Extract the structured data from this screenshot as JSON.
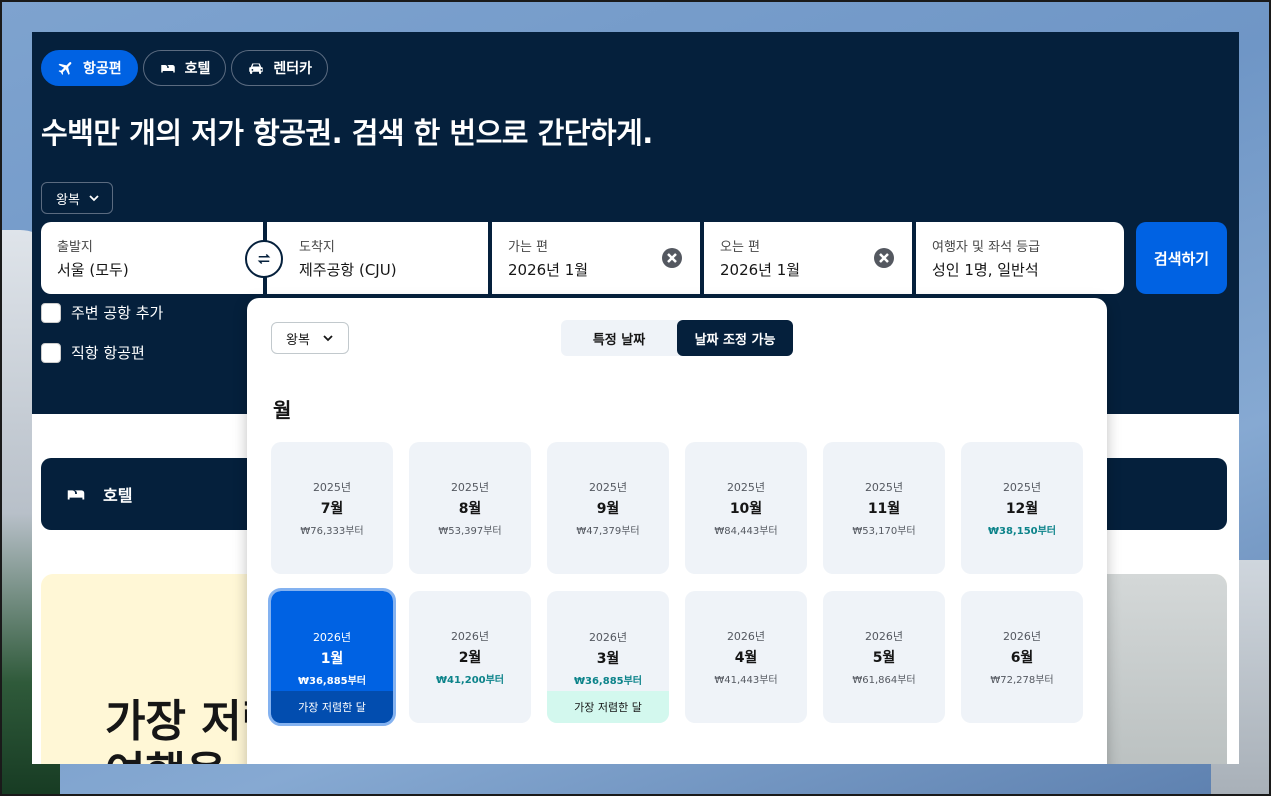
{
  "tabs": [
    {
      "label": "항공편",
      "icon": "airplane-icon",
      "active": true
    },
    {
      "label": "호텔",
      "icon": "bed-icon",
      "active": false
    },
    {
      "label": "렌터카",
      "icon": "car-icon",
      "active": false
    }
  ],
  "hero_title": "수백만 개의 저가 항공권. 검색 한 번으로 간단하게.",
  "trip_type": "왕복",
  "fields": {
    "origin": {
      "label": "출발지",
      "value": "서울 (모두)"
    },
    "destination": {
      "label": "도착지",
      "value": "제주공항 (CJU)"
    },
    "depart": {
      "label": "가는 편",
      "value": "2026년 1월"
    },
    "return": {
      "label": "오는 편",
      "value": "2026년 1월"
    },
    "travelers": {
      "label": "여행자 및 좌석 등급",
      "value": "성인 1명, 일반석"
    }
  },
  "search_label": "검색하기",
  "checkboxes": [
    {
      "label": "주변 공항 추가",
      "checked": false
    },
    {
      "label": "직항 항공편",
      "checked": false
    }
  ],
  "hotel_bar_label": "호텔",
  "promo_title_lines": [
    "가장 저렴",
    "여행을"
  ],
  "popover": {
    "trip_type": "왕복",
    "toggle": [
      "특정 날짜",
      "날짜 조정 가능"
    ],
    "toggle_active": 1,
    "heading": "월",
    "months": [
      {
        "year": "2025년",
        "month": "7월",
        "price": "₩76,333부터",
        "cheap": false,
        "selected": false,
        "tag": ""
      },
      {
        "year": "2025년",
        "month": "8월",
        "price": "₩53,397부터",
        "cheap": false,
        "selected": false,
        "tag": ""
      },
      {
        "year": "2025년",
        "month": "9월",
        "price": "₩47,379부터",
        "cheap": false,
        "selected": false,
        "tag": ""
      },
      {
        "year": "2025년",
        "month": "10월",
        "price": "₩84,443부터",
        "cheap": false,
        "selected": false,
        "tag": ""
      },
      {
        "year": "2025년",
        "month": "11월",
        "price": "₩53,170부터",
        "cheap": false,
        "selected": false,
        "tag": ""
      },
      {
        "year": "2025년",
        "month": "12월",
        "price": "₩38,150부터",
        "cheap": true,
        "selected": false,
        "tag": ""
      },
      {
        "year": "2026년",
        "month": "1월",
        "price": "₩36,885부터",
        "cheap": true,
        "selected": true,
        "tag": "가장 저렴한 달"
      },
      {
        "year": "2026년",
        "month": "2월",
        "price": "₩41,200부터",
        "cheap": true,
        "selected": false,
        "tag": ""
      },
      {
        "year": "2026년",
        "month": "3월",
        "price": "₩36,885부터",
        "cheap": true,
        "selected": false,
        "tag": "가장 저렴한 달"
      },
      {
        "year": "2026년",
        "month": "4월",
        "price": "₩41,443부터",
        "cheap": false,
        "selected": false,
        "tag": ""
      },
      {
        "year": "2026년",
        "month": "5월",
        "price": "₩61,864부터",
        "cheap": false,
        "selected": false,
        "tag": ""
      },
      {
        "year": "2026년",
        "month": "6월",
        "price": "₩72,278부터",
        "cheap": false,
        "selected": false,
        "tag": ""
      }
    ]
  },
  "colors": {
    "navy": "#05203c",
    "brand_blue": "#0062e3",
    "cheap_green": "#0c838a",
    "cheap_tag_bg": "#d3f8ee"
  }
}
